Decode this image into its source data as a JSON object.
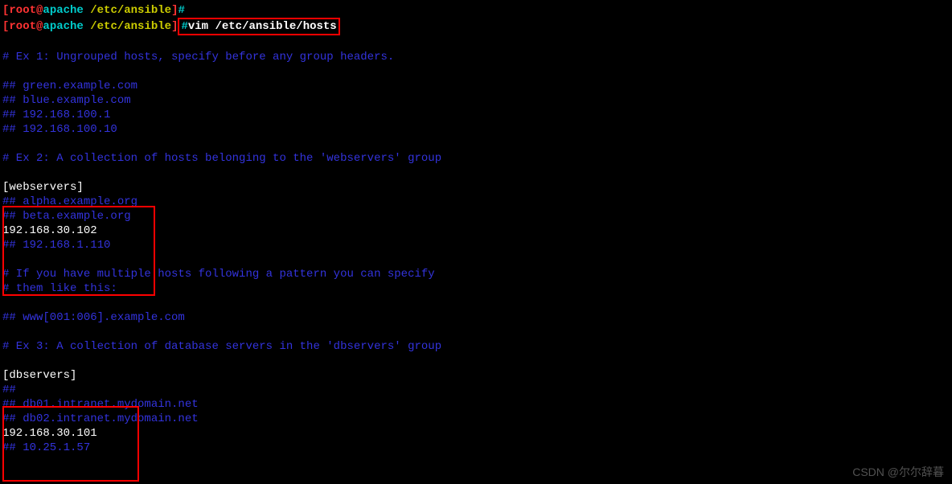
{
  "prompt": {
    "user": "root",
    "at": "@",
    "host": "apache",
    "path": " /etc/ansible",
    "bracket_open": "[",
    "bracket_close": "]",
    "hash": "#"
  },
  "command": "vim /etc/ansible/hosts",
  "file": {
    "line1": "# Ex 1: Ungrouped hosts, specify before any group headers.",
    "line2": "## green.example.com",
    "line3": "## blue.example.com",
    "line4": "## 192.168.100.1",
    "line5": "## 192.168.100.10",
    "line6": "# Ex 2: A collection of hosts belonging to the 'webservers' group",
    "line7": "[webservers]",
    "line8": "## alpha.example.org",
    "line9": "## beta.example.org",
    "line10": "192.168.30.102",
    "line11": "## 192.168.1.110",
    "line12": "# If you have multiple hosts following a pattern you can specify",
    "line13": "# them like this:",
    "line14": "## www[001:006].example.com",
    "line15": "# Ex 3: A collection of database servers in the 'dbservers' group",
    "line16": "[dbservers]",
    "line17": "##",
    "line18": "## db01.intranet.mydomain.net",
    "line19": "## db02.intranet.mydomain.net",
    "line20": "192.168.30.101",
    "line21": "## 10.25.1.57"
  },
  "watermark": "CSDN @尔尔辞暮"
}
